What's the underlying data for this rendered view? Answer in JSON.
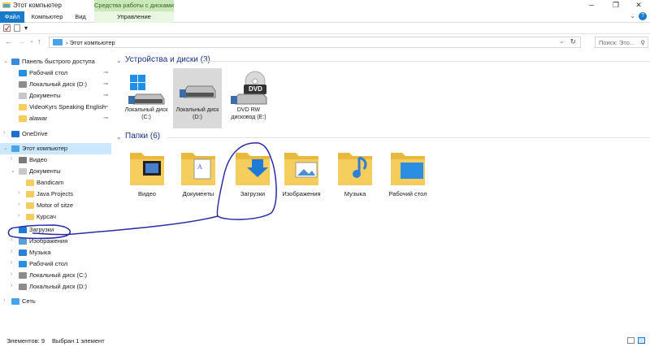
{
  "window": {
    "title": "Этот компьютер",
    "context_tab_header": "Средства работы с дисками",
    "controls": {
      "minimize": "─",
      "maximize": "❐",
      "close": "✕"
    }
  },
  "ribbon": {
    "tabs": [
      {
        "label": "Файл"
      },
      {
        "label": "Компьютер"
      },
      {
        "label": "Вид"
      },
      {
        "label": "Управление"
      }
    ],
    "collapse_glyph": "⌄",
    "help_glyph": "?"
  },
  "quick_access_toolbar": {
    "dropdown_glyph": "▾"
  },
  "address_bar": {
    "back": "←",
    "forward": "→",
    "recent": "⌄",
    "up": "↑",
    "breadcrumb": "Этот компьютер",
    "separator": "›",
    "dropdown": "⌄",
    "refresh": "↻",
    "search_placeholder": "Поиск: Это...",
    "search_icon": "⚲"
  },
  "sidebar": {
    "items": [
      {
        "label": "Панель быстрого доступа",
        "arrow": "⌄",
        "icon": "star-icon",
        "level": 0,
        "pinned": false
      },
      {
        "label": "Рабочий стол",
        "arrow": "",
        "icon": "desktop-icon",
        "level": 1,
        "pinned": true
      },
      {
        "label": "Локальный диск (D:)",
        "arrow": "",
        "icon": "drive-icon",
        "level": 1,
        "pinned": true
      },
      {
        "label": "Документы",
        "arrow": "",
        "icon": "documents-icon",
        "level": 1,
        "pinned": true
      },
      {
        "label": "VideoKyrs Speaking English",
        "arrow": "",
        "icon": "folder-icon",
        "level": 1,
        "pinned": true
      },
      {
        "label": "alawar",
        "arrow": "",
        "icon": "folder-icon",
        "level": 1,
        "pinned": true
      },
      {
        "label": "OneDrive",
        "arrow": "›",
        "icon": "cloud-icon",
        "level": 0,
        "pinned": false
      },
      {
        "label": "Этот компьютер",
        "arrow": "⌄",
        "icon": "computer-icon",
        "level": 0,
        "pinned": false
      },
      {
        "label": "Видео",
        "arrow": "›",
        "icon": "video-icon",
        "level": 1,
        "pinned": false
      },
      {
        "label": "Документы",
        "arrow": "⌄",
        "icon": "documents-icon",
        "level": 1,
        "pinned": false
      },
      {
        "label": "Bandicam",
        "arrow": "",
        "icon": "folder-icon",
        "level": 2,
        "pinned": false
      },
      {
        "label": "Java Projects",
        "arrow": "›",
        "icon": "folder-icon",
        "level": 2,
        "pinned": false
      },
      {
        "label": "Motor of sitze",
        "arrow": "›",
        "icon": "folder-icon",
        "level": 2,
        "pinned": false
      },
      {
        "label": "Курсач",
        "arrow": "›",
        "icon": "folder-icon",
        "level": 2,
        "pinned": false
      },
      {
        "label": "Загрузки",
        "arrow": "›",
        "icon": "downloads-icon",
        "level": 1,
        "pinned": false
      },
      {
        "label": "Изображения",
        "arrow": "›",
        "icon": "pictures-icon",
        "level": 1,
        "pinned": false
      },
      {
        "label": "Музыка",
        "arrow": "›",
        "icon": "music-icon",
        "level": 1,
        "pinned": false
      },
      {
        "label": "Рабочий стол",
        "arrow": "›",
        "icon": "desktop-icon",
        "level": 1,
        "pinned": false
      },
      {
        "label": "Локальный диск (C:)",
        "arrow": "›",
        "icon": "drive-icon",
        "level": 1,
        "pinned": false
      },
      {
        "label": "Локальный диск (D:)",
        "arrow": "›",
        "icon": "drive-icon",
        "level": 1,
        "pinned": false
      },
      {
        "label": "Сеть",
        "arrow": "›",
        "icon": "network-icon",
        "level": 0,
        "pinned": false
      }
    ],
    "pin_glyph": "📌"
  },
  "main": {
    "devices_header": "Устройства и диски (3)",
    "folders_header": "Папки (6)",
    "collapse_glyph": "⌄",
    "drives": [
      {
        "label_line1": "Локальный диск",
        "label_line2": "(C:)",
        "icon": "windows-drive-icon"
      },
      {
        "label_line1": "Локальный диск",
        "label_line2": "(D:)",
        "icon": "drive-icon",
        "selected": true
      },
      {
        "label_line1": "DVD RW",
        "label_line2": "дисковод (E:)",
        "icon": "dvd-drive-icon",
        "badge": "DVD"
      }
    ],
    "folders": [
      {
        "label": "Видео",
        "icon": "video-folder-icon"
      },
      {
        "label": "Документы",
        "icon": "documents-folder-icon"
      },
      {
        "label": "Загрузки",
        "icon": "downloads-folder-icon"
      },
      {
        "label": "Изображения",
        "icon": "pictures-folder-icon"
      },
      {
        "label": "Музыка",
        "icon": "music-folder-icon"
      },
      {
        "label": "Рабочий стол",
        "icon": "desktop-folder-icon"
      }
    ]
  },
  "statusbar": {
    "items_count": "Элементов: 9",
    "selection": "Выбран 1 элемент"
  },
  "colors": {
    "accent": "#1979ca",
    "selection": "#cce8ff",
    "folder": "#f4cd5c",
    "annotation": "#2a2aa8",
    "context_tab": "#c9e9b8"
  }
}
